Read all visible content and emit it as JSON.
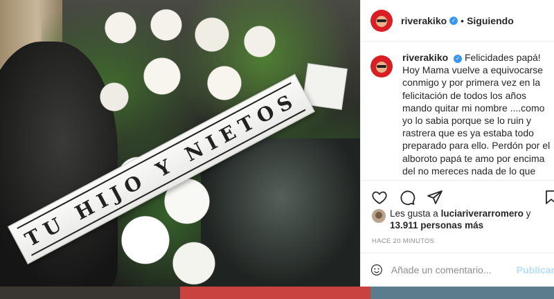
{
  "post": {
    "ribbon_text": "TU HIJO Y NIETOS",
    "username": "riverakiko",
    "follow_label": "Siguiendo",
    "caption_title": "Felicidades papá!",
    "caption_body": "Hoy Mama vuelve a equivocarse conmigo y por primera vez en la felicitación de todos los años mando quitar mi nombre ....como yo lo sabia porque se lo ruin y rastrera que es ya estaba todo preparado para ello. Perdón por el alboroto papá te amo por encima del  no mereces nada de lo que mamá está haciendo pero tranquilo todo estará en orden dentro",
    "likes_prefix": "Les gusta a",
    "likes_user": "luciariverarromero",
    "likes_connector": "y",
    "likes_count": "13.911 personas más",
    "time_label": "HACE 20 MINUTOS",
    "comment_placeholder": "Añade un comentario...",
    "publish_label": "Publicar"
  },
  "colors": {
    "verified": "#3897f0",
    "publish": "#b2dffc",
    "avatar_bg": "#d91f26"
  },
  "icons": [
    "heart-icon",
    "comment-icon",
    "share-icon",
    "bookmark-icon",
    "emoji-icon",
    "verified-icon"
  ]
}
